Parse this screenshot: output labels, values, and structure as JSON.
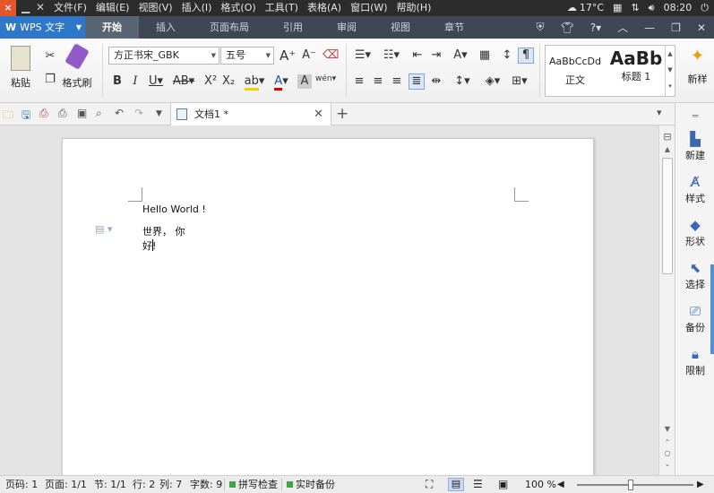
{
  "system_bar": {
    "menu": [
      "文件(F)",
      "编辑(E)",
      "视图(V)",
      "插入(I)",
      "格式(O)",
      "工具(T)",
      "表格(A)",
      "窗口(W)",
      "帮助(H)"
    ],
    "temperature": "17°C",
    "time": "08:20"
  },
  "app": {
    "name": "WPS 文字"
  },
  "tabs": [
    "开始",
    "插入",
    "页面布局",
    "引用",
    "审阅",
    "视图",
    "章节"
  ],
  "active_tab": "开始",
  "ribbon": {
    "paste_label": "粘贴",
    "format_painter_label": "格式刷",
    "font_name": "方正书宋_GBK",
    "font_size": "五号",
    "style_normal_preview": "AaBbCcDd",
    "style_normal_label": "正文",
    "style_heading_preview": "AaBb",
    "style_heading_label": "标题 1",
    "new_style_label": "新样"
  },
  "document_tab": {
    "title": "文档1 *"
  },
  "document": {
    "lines": [
      "Hello World !",
      "世界， 你好!"
    ]
  },
  "task_pane": {
    "items": [
      "新建",
      "样式",
      "形状",
      "选择",
      "备份",
      "限制"
    ]
  },
  "status_bar": {
    "page_num": "页码: 1",
    "pages": "页面: 1/1",
    "section": "节: 1/1",
    "row": "行: 2",
    "col": "列: 7",
    "word_count": "字数: 9",
    "spell_check": "拼写检查",
    "realtime_backup": "实时备份",
    "zoom": "100 %",
    "zoom_fraction": 0.46
  }
}
